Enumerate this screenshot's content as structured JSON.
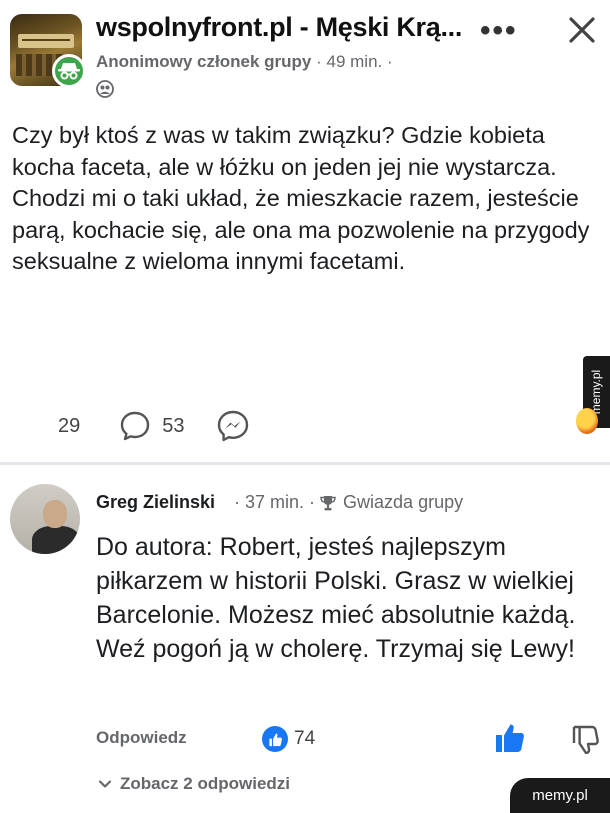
{
  "header": {
    "group_title": "wspolnyfront.pl - Męski Krą...",
    "author_label": "Anonimowy członek grupy",
    "separator": "·",
    "time": "49 min.",
    "time_suffix": "·"
  },
  "post": {
    "text": "Czy był ktoś z was w takim związku? Gdzie kobieta kocha faceta, ale w łóżku on jeden jej nie wystarcza.\nChodzi mi o taki układ, że mieszkacie razem, jesteście parą, kochacie się, ale ona ma pozwolenie na przygody seksualne z wieloma innymi facetami.",
    "likes": "29",
    "comments": "53"
  },
  "comment": {
    "author": "Greg Zielinski",
    "meta_time": "· 37 min. ·",
    "badge": "Gwiazda grupy",
    "text": "Do autora: Robert, jesteś najlepszym piłkarzem w historii Polski. Grasz w wielkiej Barcelonie. Możesz mieć absolutnie każdą. Weź pogoń ją w cholerę. Trzymaj się Lewy!",
    "reply_label": "Odpowiedz",
    "likes": "74",
    "view_replies": "Zobacz 2 odpowiedzi"
  },
  "watermark": {
    "side": "memy.pl",
    "corner": "memy.pl"
  },
  "colors": {
    "accent": "#1877f2",
    "anon_badge": "#3fa54a",
    "muted_text": "#65676b"
  },
  "icons": [
    "more-icon",
    "close-icon",
    "anonymous-icon",
    "privacy-icon",
    "comment-icon",
    "messenger-icon",
    "trophy-icon",
    "like-icon",
    "thumb-up-icon",
    "thumb-down-icon",
    "chevron-down-icon"
  ]
}
